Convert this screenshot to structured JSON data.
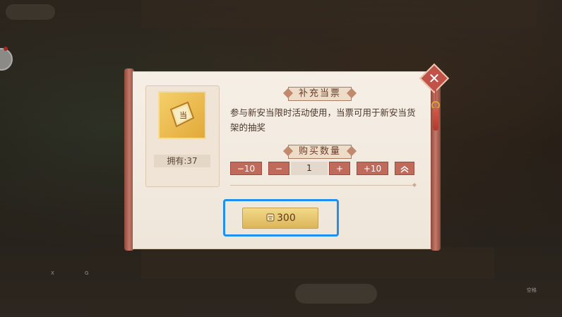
{
  "background": {
    "top_tab": "",
    "hint_x": "X",
    "hint_g": "G",
    "hint_space": "空格"
  },
  "dialog": {
    "title": "补充当票",
    "description": "参与新安当限时活动使用，当票可用于新安当货架的抽奖",
    "item": {
      "icon": "ticket-icon",
      "owned_label": "拥有:37"
    },
    "quantity": {
      "title": "购买数量",
      "minus10_label": "−10",
      "minus_label": "−",
      "value": "1",
      "plus_label": "+",
      "plus10_label": "+10",
      "max_icon": "double-chevron-up-icon"
    },
    "buy_button": {
      "price": "300",
      "icon": "coin-icon"
    },
    "close_icon": "close-icon"
  },
  "colors": {
    "highlight": "#1f8ff0",
    "accent_red": "#c06a5c",
    "gold": "#e2a93a"
  }
}
